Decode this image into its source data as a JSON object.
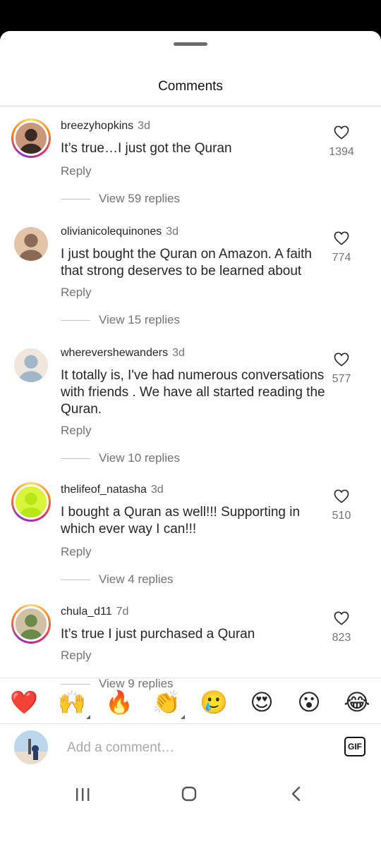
{
  "sheet": {
    "title": "Comments"
  },
  "comments": [
    {
      "username": "breezyhopkins",
      "time": "3d",
      "text": "It’s true…I just got the Quran",
      "likes": "1394",
      "reply_label": "Reply",
      "view_replies": "View 59 replies",
      "avatar_ring": true,
      "avatar_colors": [
        "#3a2a25",
        "#c9977a"
      ]
    },
    {
      "username": "olivianicolequinones",
      "time": "3d",
      "text": "I just bought the Quran on Amazon. A faith that strong deserves to be learned about",
      "likes": "774",
      "reply_label": "Reply",
      "view_replies": "View 15 replies",
      "avatar_ring": false,
      "avatar_colors": [
        "#8b6a55",
        "#e2c4a8"
      ]
    },
    {
      "username": "wherevershewanders",
      "time": "3d",
      "text": "It totally is, I've had numerous conversations with friends . We have all started reading the Quran.",
      "likes": "577",
      "reply_label": "Reply",
      "view_replies": "View 10 replies",
      "avatar_ring": false,
      "avatar_colors": [
        "#9fb7c8",
        "#f1e6dc"
      ]
    },
    {
      "username": "thelifeof_natasha",
      "time": "3d",
      "text": "I bought a Quran as well!!! Supporting in which ever way I can!!!",
      "likes": "510",
      "reply_label": "Reply",
      "view_replies": "View 4 replies",
      "avatar_ring": true,
      "avatar_colors": [
        "#b8e617",
        "#d9f53a"
      ]
    },
    {
      "username": "chula_d11",
      "time": "7d",
      "text": "It’s true I just purchased a Quran",
      "likes": "823",
      "reply_label": "Reply",
      "view_replies": "View 9 replies",
      "avatar_ring": true,
      "avatar_colors": [
        "#6d8a4a",
        "#cfc2a4"
      ]
    }
  ],
  "emoji_bar": [
    {
      "glyph": "❤️",
      "name": "red-heart"
    },
    {
      "glyph": "🙌",
      "name": "raising-hands",
      "has_variants": true
    },
    {
      "glyph": "🔥",
      "name": "fire"
    },
    {
      "glyph": "👏",
      "name": "clapping-hands",
      "has_variants": true
    },
    {
      "glyph": "🥲",
      "name": "smiling-tear"
    },
    {
      "glyph": "😍",
      "name": "heart-eyes"
    },
    {
      "glyph": "😮",
      "name": "open-mouth"
    },
    {
      "glyph": "😂",
      "name": "tears-of-joy"
    }
  ],
  "composer": {
    "placeholder": "Add a comment…",
    "gif_label": "GIF"
  },
  "colors": {
    "secondary_text": "#737373",
    "primary_text": "#262626",
    "divider": "#dbdbdb"
  },
  "icons": {
    "like": "heart-outline-icon",
    "nav_recents": "recents-icon",
    "nav_home": "home-icon",
    "nav_back": "back-icon"
  }
}
